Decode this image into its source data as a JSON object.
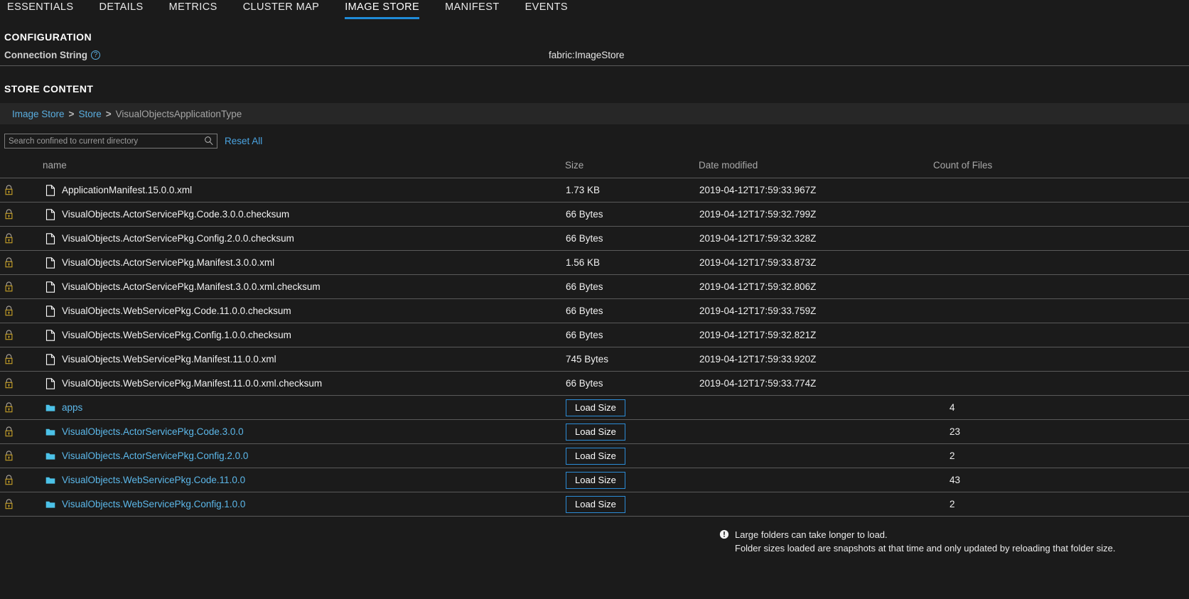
{
  "tabs": [
    {
      "label": "ESSENTIALS",
      "active": false
    },
    {
      "label": "DETAILS",
      "active": false
    },
    {
      "label": "METRICS",
      "active": false
    },
    {
      "label": "CLUSTER MAP",
      "active": false
    },
    {
      "label": "IMAGE STORE",
      "active": true
    },
    {
      "label": "MANIFEST",
      "active": false
    },
    {
      "label": "EVENTS",
      "active": false
    }
  ],
  "configuration": {
    "heading": "CONFIGURATION",
    "connection_string_label": "Connection String",
    "help_glyph": "?",
    "connection_string_value": "fabric:ImageStore"
  },
  "store_content": {
    "heading": "STORE CONTENT",
    "breadcrumb": {
      "items": [
        "Image Store",
        "Store"
      ],
      "separator": ">",
      "current": "VisualObjectsApplicationType"
    },
    "search": {
      "placeholder": "Search confined to current directory",
      "value": "",
      "icon": "search-icon"
    },
    "reset_label": "Reset All",
    "columns": {
      "lock": "",
      "name": "name",
      "size": "Size",
      "date": "Date modified",
      "count": "Count of Files"
    },
    "rows": [
      {
        "type": "file",
        "locked": true,
        "name": "ApplicationManifest.15.0.0.xml",
        "size": "1.73 KB",
        "date": "2019-04-12T17:59:33.967Z",
        "count": ""
      },
      {
        "type": "file",
        "locked": true,
        "name": "VisualObjects.ActorServicePkg.Code.3.0.0.checksum",
        "size": "66 Bytes",
        "date": "2019-04-12T17:59:32.799Z",
        "count": ""
      },
      {
        "type": "file",
        "locked": true,
        "name": "VisualObjects.ActorServicePkg.Config.2.0.0.checksum",
        "size": "66 Bytes",
        "date": "2019-04-12T17:59:32.328Z",
        "count": ""
      },
      {
        "type": "file",
        "locked": true,
        "name": "VisualObjects.ActorServicePkg.Manifest.3.0.0.xml",
        "size": "1.56 KB",
        "date": "2019-04-12T17:59:33.873Z",
        "count": ""
      },
      {
        "type": "file",
        "locked": true,
        "name": "VisualObjects.ActorServicePkg.Manifest.3.0.0.xml.checksum",
        "size": "66 Bytes",
        "date": "2019-04-12T17:59:32.806Z",
        "count": ""
      },
      {
        "type": "file",
        "locked": true,
        "name": "VisualObjects.WebServicePkg.Code.11.0.0.checksum",
        "size": "66 Bytes",
        "date": "2019-04-12T17:59:33.759Z",
        "count": ""
      },
      {
        "type": "file",
        "locked": true,
        "name": "VisualObjects.WebServicePkg.Config.1.0.0.checksum",
        "size": "66 Bytes",
        "date": "2019-04-12T17:59:32.821Z",
        "count": ""
      },
      {
        "type": "file",
        "locked": true,
        "name": "VisualObjects.WebServicePkg.Manifest.11.0.0.xml",
        "size": "745 Bytes",
        "date": "2019-04-12T17:59:33.920Z",
        "count": ""
      },
      {
        "type": "file",
        "locked": true,
        "name": "VisualObjects.WebServicePkg.Manifest.11.0.0.xml.checksum",
        "size": "66 Bytes",
        "date": "2019-04-12T17:59:33.774Z",
        "count": ""
      },
      {
        "type": "folder",
        "locked": true,
        "name": "apps",
        "size": "Load Size",
        "date": "",
        "count": "4"
      },
      {
        "type": "folder",
        "locked": true,
        "name": "VisualObjects.ActorServicePkg.Code.3.0.0",
        "size": "Load Size",
        "date": "",
        "count": "23"
      },
      {
        "type": "folder",
        "locked": true,
        "name": "VisualObjects.ActorServicePkg.Config.2.0.0",
        "size": "Load Size",
        "date": "",
        "count": "2"
      },
      {
        "type": "folder",
        "locked": true,
        "name": "VisualObjects.WebServicePkg.Code.11.0.0",
        "size": "Load Size",
        "date": "",
        "count": "43"
      },
      {
        "type": "folder",
        "locked": true,
        "name": "VisualObjects.WebServicePkg.Config.1.0.0",
        "size": "Load Size",
        "date": "",
        "count": "2"
      }
    ],
    "footer_note": {
      "line1": "Large folders can take longer to load.",
      "line2": "Folder sizes loaded are snapshots at that time and only updated by reloading that folder size."
    }
  },
  "colors": {
    "background": "#1b1b1b",
    "accent_blue": "#1f8bd8",
    "link_blue": "#5aaee0",
    "folder_cyan": "#4cc2e8",
    "row_divider": "#5a5a5a",
    "breadcrumb_bg": "#272727",
    "lock_gold": "#c9a227"
  }
}
